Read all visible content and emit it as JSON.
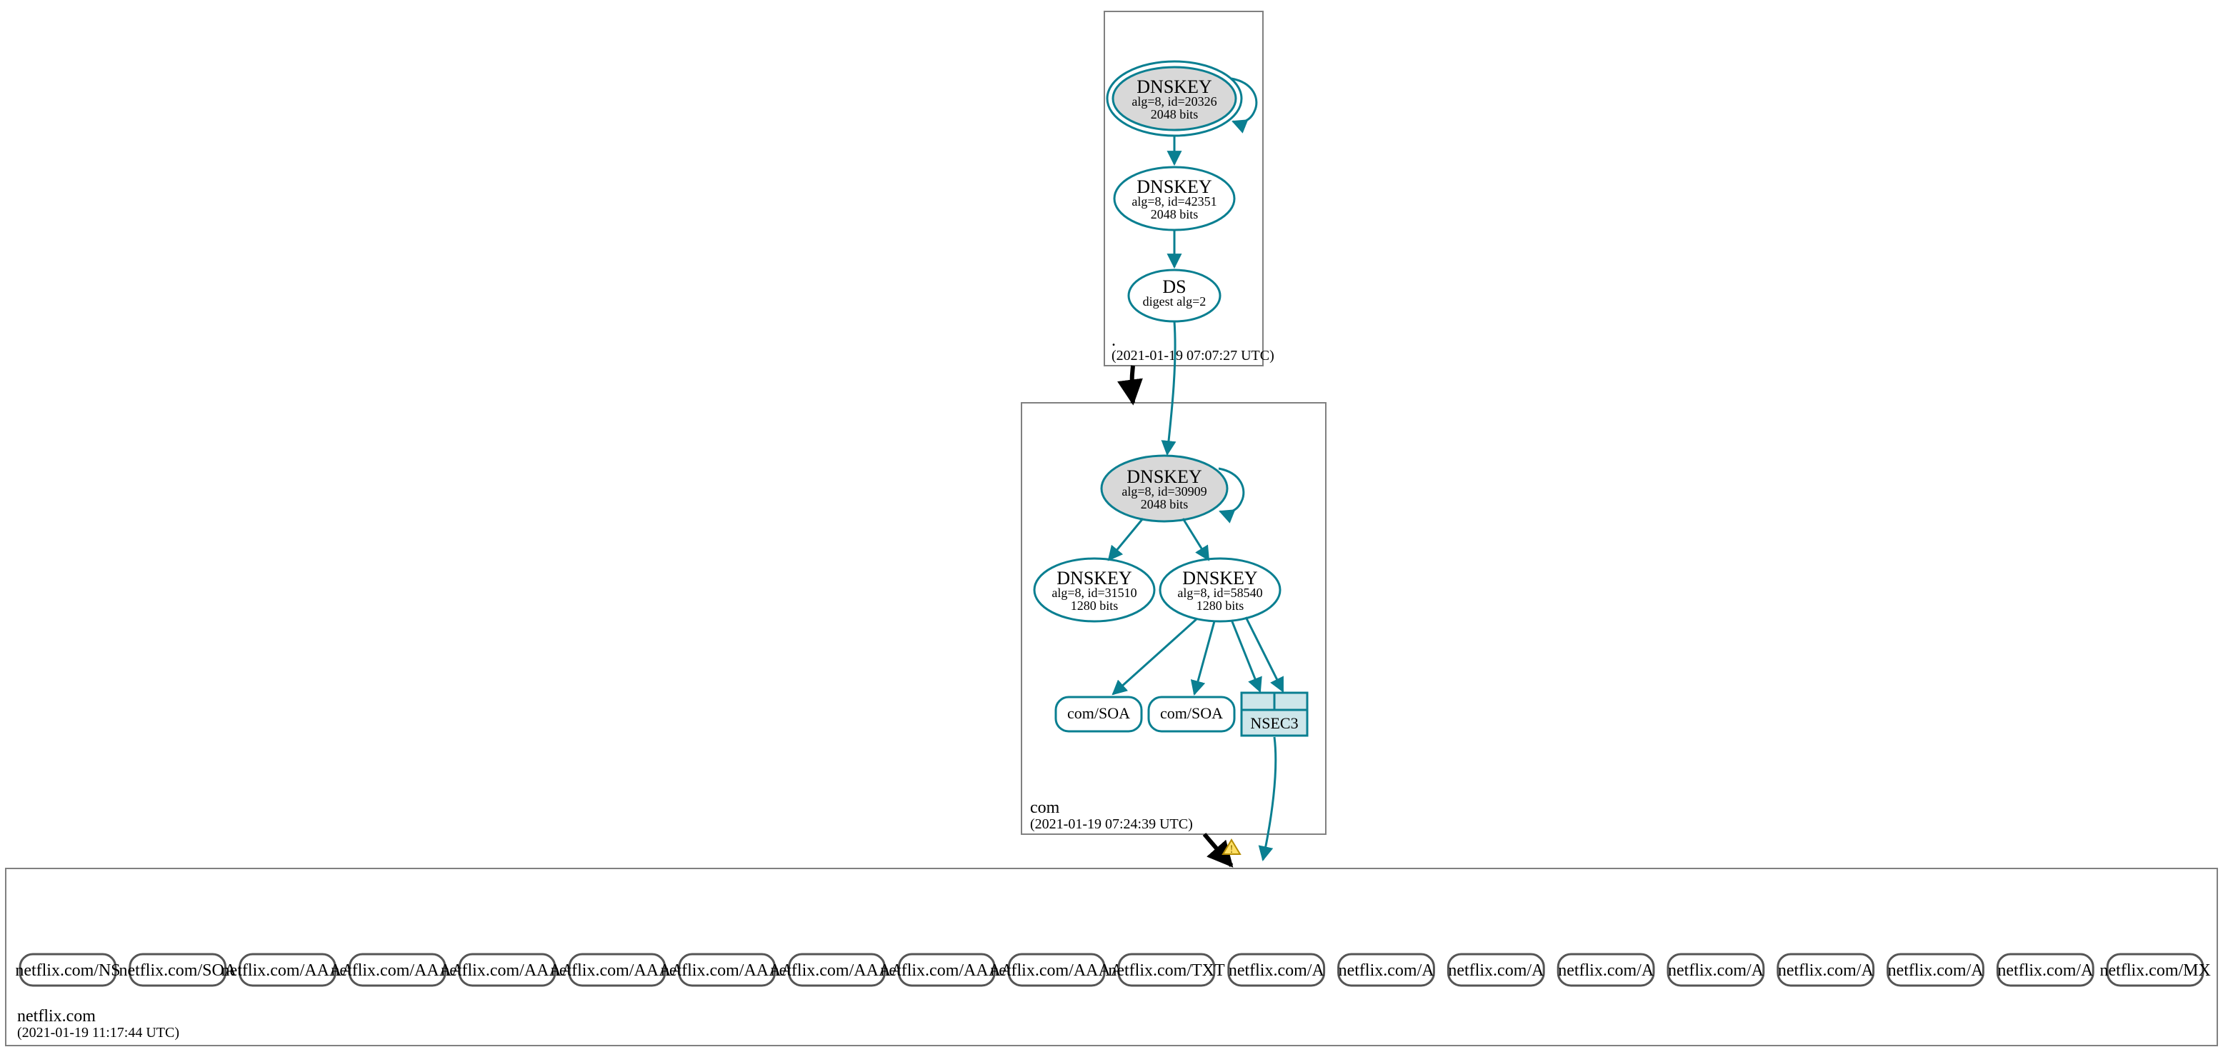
{
  "colors": {
    "teal": "#0a7f91",
    "ksk_fill": "#d8d8d8",
    "nsec3_fill": "#cde6ea"
  },
  "zones": {
    "root": {
      "label": ".",
      "timestamp": "(2021-01-19 07:07:27 UTC)"
    },
    "com": {
      "label": "com",
      "timestamp": "(2021-01-19 07:24:39 UTC)"
    },
    "leaf": {
      "label": "netflix.com",
      "timestamp": "(2021-01-19 11:17:44 UTC)"
    }
  },
  "root_nodes": {
    "ksk": {
      "title": "DNSKEY",
      "line2": "alg=8, id=20326",
      "line3": "2048 bits"
    },
    "zsk": {
      "title": "DNSKEY",
      "line2": "alg=8, id=42351",
      "line3": "2048 bits"
    },
    "ds": {
      "title": "DS",
      "line2": "digest alg=2"
    }
  },
  "com_nodes": {
    "ksk": {
      "title": "DNSKEY",
      "line2": "alg=8, id=30909",
      "line3": "2048 bits"
    },
    "zsk1": {
      "title": "DNSKEY",
      "line2": "alg=8, id=31510",
      "line3": "1280 bits"
    },
    "zsk2": {
      "title": "DNSKEY",
      "line2": "alg=8, id=58540",
      "line3": "1280 bits"
    },
    "soa1": {
      "label": "com/SOA"
    },
    "soa2": {
      "label": "com/SOA"
    },
    "nsec3": {
      "label": "NSEC3"
    }
  },
  "leaf_records": [
    "netflix.com/NS",
    "netflix.com/SOA",
    "netflix.com/AAAA",
    "netflix.com/AAAA",
    "netflix.com/AAAA",
    "netflix.com/AAAA",
    "netflix.com/AAAA",
    "netflix.com/AAAA",
    "netflix.com/AAAA",
    "netflix.com/AAAA",
    "netflix.com/TXT",
    "netflix.com/A",
    "netflix.com/A",
    "netflix.com/A",
    "netflix.com/A",
    "netflix.com/A",
    "netflix.com/A",
    "netflix.com/A",
    "netflix.com/A",
    "netflix.com/MX"
  ]
}
